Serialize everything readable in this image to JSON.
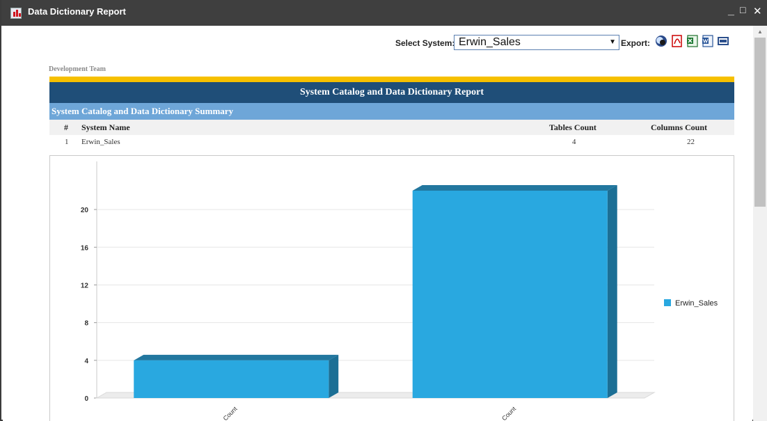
{
  "window": {
    "title": "Data Dictionary Report",
    "minimize": "_",
    "maximize": "□",
    "close": "✕"
  },
  "toolbar": {
    "select_label": "Select System:",
    "selected_system": "Erwin_Sales",
    "export_label": "Export:",
    "export_icons": [
      "html-export-icon",
      "pdf-export-icon",
      "excel-export-icon",
      "word-export-icon",
      "rtf-export-icon"
    ]
  },
  "report": {
    "team": "Development Team",
    "title": "System Catalog and Data Dictionary Report",
    "summary_title": "System Catalog and Data Dictionary Summary",
    "columns": [
      "#",
      "System Name",
      "Tables Count",
      "Columns Count"
    ],
    "rows": [
      {
        "num": "1",
        "system": "Erwin_Sales",
        "tables": "4",
        "columns": "22"
      }
    ]
  },
  "colors": {
    "accent_gold": "#f6c000",
    "header_navy": "#1f4e78",
    "subheader_blue": "#6ea6d8",
    "bar_face": "#29a8e0",
    "bar_side": "#1c6f95"
  },
  "chart_data": {
    "type": "bar",
    "categories": [
      "Tables Count",
      "Columns Count"
    ],
    "visible_category_labels": [
      "Count",
      "Count"
    ],
    "series": [
      {
        "name": "Erwin_Sales",
        "values": [
          4,
          22
        ]
      }
    ],
    "ylim": [
      0,
      22
    ],
    "yticks": [
      "0",
      "4",
      "8",
      "12",
      "16",
      "20"
    ],
    "legend": "right",
    "grid": true,
    "style": "3d"
  }
}
